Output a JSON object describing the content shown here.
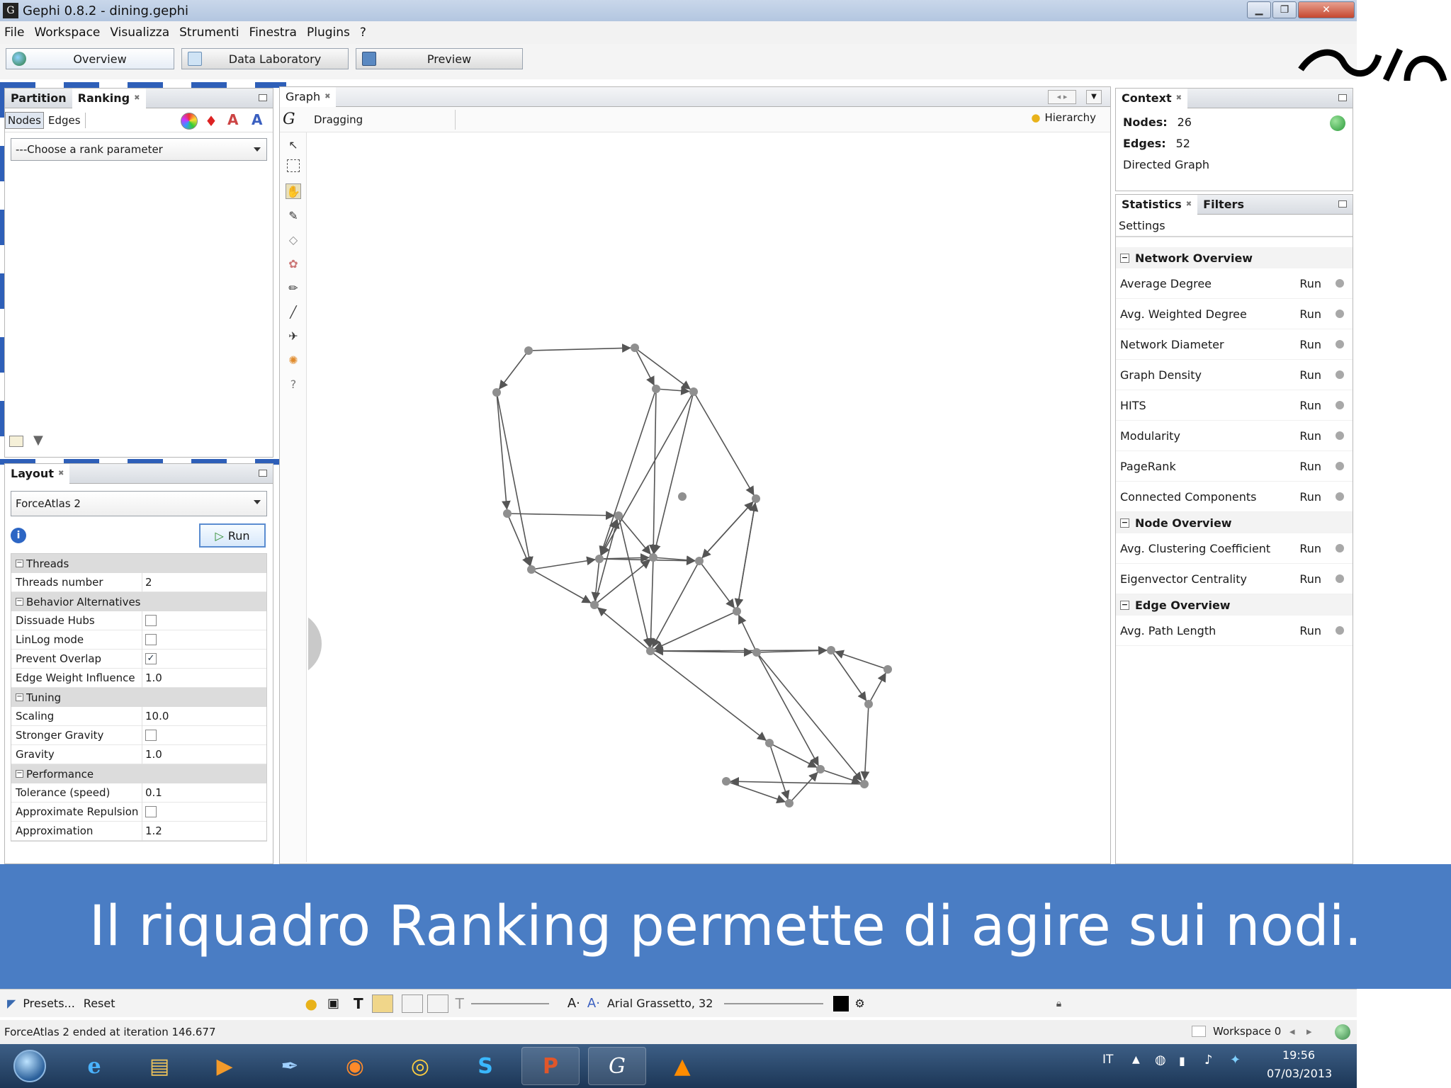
{
  "window": {
    "title": "Gephi 0.8.2 - dining.gephi"
  },
  "menu": [
    "File",
    "Workspace",
    "Visualizza",
    "Strumenti",
    "Finestra",
    "Plugins",
    "?"
  ],
  "workspace_tabs": [
    {
      "label": "Overview"
    },
    {
      "label": "Data Laboratory"
    },
    {
      "label": "Preview"
    }
  ],
  "ranking_panel": {
    "tabs": [
      "Partition",
      "Ranking"
    ],
    "subtabs": [
      "Nodes",
      "Edges"
    ],
    "rank_parameter": "---Choose a rank parameter"
  },
  "layout_panel": {
    "tab": "Layout",
    "algorithm": "ForceAtlas 2",
    "run_label": "Run",
    "categories": {
      "threads": "Threads",
      "behavior": "Behavior Alternatives",
      "tuning": "Tuning",
      "performance": "Performance"
    },
    "props": {
      "threads_number": {
        "name": "Threads number",
        "value": "2"
      },
      "dissuade_hubs": {
        "name": "Dissuade Hubs",
        "checked": false
      },
      "linlog_mode": {
        "name": "LinLog mode",
        "checked": false
      },
      "prevent_overlap": {
        "name": "Prevent Overlap",
        "checked": true,
        "mark": "✓"
      },
      "edge_weight_influence": {
        "name": "Edge Weight Influence",
        "value": "1.0"
      },
      "scaling": {
        "name": "Scaling",
        "value": "10.0"
      },
      "stronger_gravity": {
        "name": "Stronger Gravity",
        "checked": false
      },
      "gravity": {
        "name": "Gravity",
        "value": "1.0"
      },
      "tolerance": {
        "name": "Tolerance (speed)",
        "value": "0.1"
      },
      "approximate_repulsion": {
        "name": "Approximate Repulsion",
        "checked": false
      },
      "approximation": {
        "name": "Approximation",
        "value": "1.2"
      }
    },
    "presets": "Presets...",
    "reset": "Reset"
  },
  "graph_panel": {
    "tab": "Graph",
    "mode": "Dragging",
    "hierarchy": "Hierarchy",
    "font_label": "Arial Grassetto, 32"
  },
  "context_panel": {
    "tab": "Context",
    "nodes_label": "Nodes:",
    "nodes_value": "26",
    "edges_label": "Edges:",
    "edges_value": "52",
    "graph_type": "Directed Graph"
  },
  "statistics_panel": {
    "tabs": [
      "Statistics",
      "Filters"
    ],
    "settings": "Settings",
    "run_label": "Run",
    "network_overview": {
      "title": "Network Overview",
      "items": [
        "Average Degree",
        "Avg. Weighted Degree",
        "Network Diameter",
        "Graph Density",
        "HITS",
        "Modularity",
        "PageRank",
        "Connected Components"
      ]
    },
    "node_overview": {
      "title": "Node Overview",
      "items": [
        "Avg. Clustering Coefficient",
        "Eigenvector Centrality"
      ]
    },
    "edge_overview": {
      "title": "Edge Overview",
      "items": [
        "Avg. Path Length"
      ]
    }
  },
  "caption": "Il riquadro Ranking permette di agire sui nodi.",
  "status": {
    "message": "ForceAtlas 2 ended at iteration 146.677",
    "workspace": "Workspace 0"
  },
  "taskbar": {
    "lang": "IT",
    "time": "19:56",
    "date": "07/03/2013",
    "apps": [
      "internet-explorer",
      "file-explorer",
      "media-player",
      "tool",
      "firefox",
      "chrome",
      "skype",
      "powerpoint",
      "gephi",
      "vlc"
    ]
  },
  "colors": {
    "caption_bg": "#4a7dc4",
    "selection_dash": "#2e5fb8",
    "node_fill": "#8f8f8f",
    "edge_color": "#555555"
  }
}
